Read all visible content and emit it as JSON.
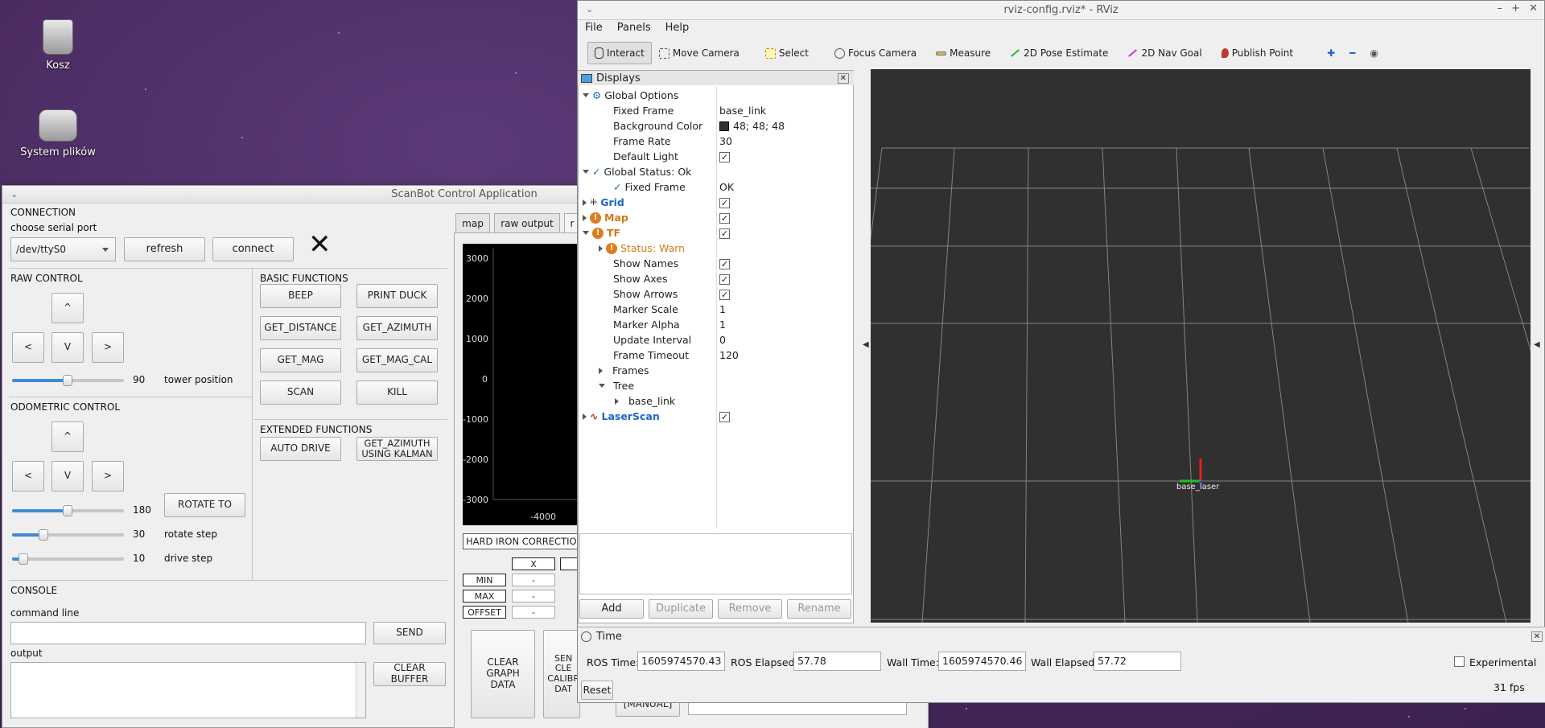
{
  "desktop": {
    "icons": [
      {
        "label": "Kosz"
      },
      {
        "label": "System plików"
      }
    ]
  },
  "scanbot": {
    "title": "ScanBot Control Application",
    "connection": {
      "heading": "CONNECTION",
      "choose_label": "choose serial port",
      "port_value": "/dev/ttyS0",
      "refresh": "refresh",
      "connect": "connect",
      "status_icon": "x-icon"
    },
    "raw_control": {
      "heading": "RAW CONTROL",
      "up": "^",
      "left": "<",
      "down": "V",
      "right": ">",
      "tower_value": "90",
      "tower_label": "tower position",
      "tower_fraction": 0.5
    },
    "basic_functions": {
      "heading": "BASIC FUNCTIONS",
      "buttons": [
        "BEEP",
        "PRINT DUCK",
        "GET_DISTANCE",
        "GET_AZIMUTH",
        "GET_MAG",
        "GET_MAG_CAL",
        "SCAN",
        "KILL"
      ]
    },
    "extended_functions": {
      "heading": "EXTENDED FUNCTIONS",
      "auto_drive": "AUTO DRIVE",
      "get_azimuth_kalman": "GET_AZIMUTH\nUSING KALMAN"
    },
    "odometric_control": {
      "heading": "ODOMETRIC CONTROL",
      "up": "^",
      "left": "<",
      "down": "V",
      "right": ">",
      "rotate_value": "180",
      "rotate_to": "ROTATE TO",
      "rotate_fraction": 0.5,
      "step_value": "30",
      "step_label": "rotate step",
      "step_fraction": 0.28,
      "drive_value": "10",
      "drive_label": "drive step",
      "drive_fraction": 0.08
    },
    "console": {
      "heading": "CONSOLE",
      "command_label": "command line",
      "send": "SEND",
      "output_label": "output",
      "clear_buffer": "CLEAR BUFFER"
    },
    "tabs": [
      "map",
      "raw output",
      "r"
    ],
    "plot": {
      "y_ticks": [
        "3000",
        "2000",
        "1000",
        "0",
        "-1000",
        "-2000",
        "-3000"
      ],
      "x_tick": "-4000"
    },
    "hard_iron": {
      "title": "HARD IRON CORRECTION",
      "col_x": "X",
      "rows": [
        "MIN",
        "MAX",
        "OFFSET"
      ],
      "values": [
        "-",
        "-",
        "-"
      ]
    },
    "bottom_buttons": {
      "clear_graph": "CLEAR\nGRAPH\nDATA",
      "send_clear_calib": "SEN\nCLE\nCALIBR\nDAT",
      "manual": "[MANUAL]"
    }
  },
  "rviz": {
    "title": "rviz-config.rviz* - RViz",
    "menu": [
      "File",
      "Panels",
      "Help"
    ],
    "tools": [
      {
        "label": "Interact",
        "icon": "hand-icon",
        "active": true
      },
      {
        "label": "Move Camera",
        "icon": "move-icon"
      },
      {
        "label": "Select",
        "icon": "select-icon"
      },
      {
        "label": "Focus Camera",
        "icon": "crosshair-icon"
      },
      {
        "label": "Measure",
        "icon": "ruler-icon"
      },
      {
        "label": "2D Pose Estimate",
        "icon": "green-arrow-icon"
      },
      {
        "label": "2D Nav Goal",
        "icon": "pink-arrow-icon"
      },
      {
        "label": "Publish Point",
        "icon": "pin-icon"
      }
    ],
    "displays": {
      "title": "Displays",
      "rows": [
        {
          "key": "Global Options",
          "val": ""
        },
        {
          "key": "Fixed Frame",
          "val": "base_link"
        },
        {
          "key": "Background Color",
          "val": "48; 48; 48"
        },
        {
          "key": "Frame Rate",
          "val": "30"
        },
        {
          "key": "Default Light",
          "val": ""
        },
        {
          "key": "Global Status: Ok",
          "val": ""
        },
        {
          "key": "Fixed Frame",
          "val": "OK"
        },
        {
          "key": "Grid",
          "val": ""
        },
        {
          "key": "Map",
          "val": ""
        },
        {
          "key": "TF",
          "val": ""
        },
        {
          "key": "Status: Warn",
          "val": ""
        },
        {
          "key": "Show Names",
          "val": ""
        },
        {
          "key": "Show Axes",
          "val": ""
        },
        {
          "key": "Show Arrows",
          "val": ""
        },
        {
          "key": "Marker Scale",
          "val": "1"
        },
        {
          "key": "Marker Alpha",
          "val": "1"
        },
        {
          "key": "Update Interval",
          "val": "0"
        },
        {
          "key": "Frame Timeout",
          "val": "120"
        },
        {
          "key": "Frames",
          "val": ""
        },
        {
          "key": "Tree",
          "val": ""
        },
        {
          "key": "base_link",
          "val": ""
        },
        {
          "key": "LaserScan",
          "val": ""
        }
      ],
      "buttons": [
        "Add",
        "Duplicate",
        "Remove",
        "Rename"
      ]
    },
    "view": {
      "frame_label": "base_laser"
    },
    "time": {
      "title": "Time",
      "ros_time_label": "ROS Time:",
      "ros_time": "1605974570.43",
      "ros_elapsed_label": "ROS Elapsed:",
      "ros_elapsed": "57.78",
      "wall_time_label": "Wall Time:",
      "wall_time": "1605974570.46",
      "wall_elapsed_label": "Wall Elapsed:",
      "wall_elapsed": "57.72",
      "experimental": "Experimental",
      "reset": "Reset",
      "fps": "31 fps"
    }
  },
  "colors": {
    "desktop_bg": "#4a2f62",
    "rviz_bg": "#303030",
    "accent": "#3d8bd6",
    "warn": "#e07b1e"
  }
}
